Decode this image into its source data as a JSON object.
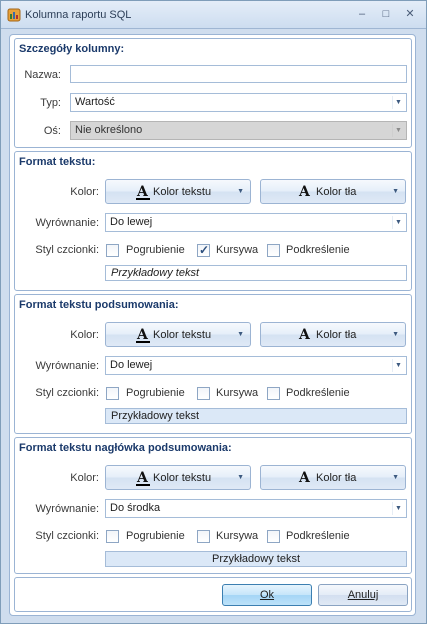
{
  "window": {
    "title": "Kolumna raportu SQL",
    "minimize": "–",
    "maximize": "□",
    "close": "✕"
  },
  "details": {
    "title": "Szczegóły kolumny:",
    "name_label": "Nazwa:",
    "name_value": "",
    "type_label": "Typ:",
    "type_value": "Wartość",
    "axis_label": "Oś:",
    "axis_value": "Nie określono"
  },
  "common": {
    "color_label": "Kolor:",
    "align_label": "Wyrównanie:",
    "style_label": "Styl czcionki:",
    "text_color": "Kolor tekstu",
    "bg_color": "Kolor tła",
    "bold": "Pogrubienie",
    "italic": "Kursywa",
    "underline": "Podkreślenie",
    "glyph": "A",
    "caret": "▼"
  },
  "sections": [
    {
      "title": "Format tekstu:",
      "align_value": "Do lewej",
      "bold": false,
      "italic": true,
      "underline": false,
      "sample": "Przykładowy tekst"
    },
    {
      "title": "Format tekstu podsumowania:",
      "align_value": "Do lewej",
      "bold": false,
      "italic": false,
      "underline": false,
      "sample": "Przykładowy tekst"
    },
    {
      "title": "Format tekstu nagłówka podsumowania:",
      "align_value": "Do środka",
      "bold": false,
      "italic": false,
      "underline": false,
      "sample": "Przykładowy tekst"
    }
  ],
  "buttons": {
    "ok": "Ok",
    "cancel": "Anuluj"
  },
  "colors": {
    "accent": "#1b3a6b",
    "window_bg": "#cfddee",
    "sample_bg": "#dbe8f7"
  }
}
